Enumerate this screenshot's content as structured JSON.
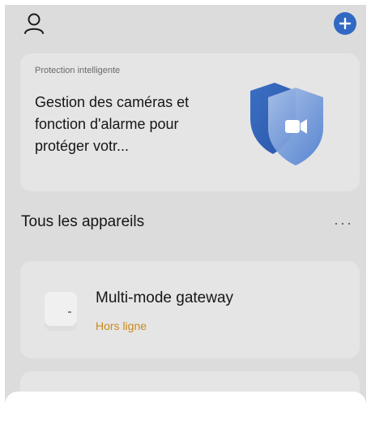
{
  "promo": {
    "kicker": "Protection intelligente",
    "body": "Gestion des caméras et fonction d'alarme pour protéger votr..."
  },
  "devices_section": {
    "title": "Tous les appareils",
    "more_label": "···"
  },
  "devices": [
    {
      "name": "Multi-mode gateway",
      "status": "Hors ligne"
    }
  ],
  "icons": {
    "profile": "person-icon",
    "add": "plus-icon",
    "shield": "camera-shield-icon"
  },
  "colors": {
    "accent": "#3068c4",
    "offline_status": "#c98a1a",
    "shield_blue": "#3b6fc4"
  }
}
